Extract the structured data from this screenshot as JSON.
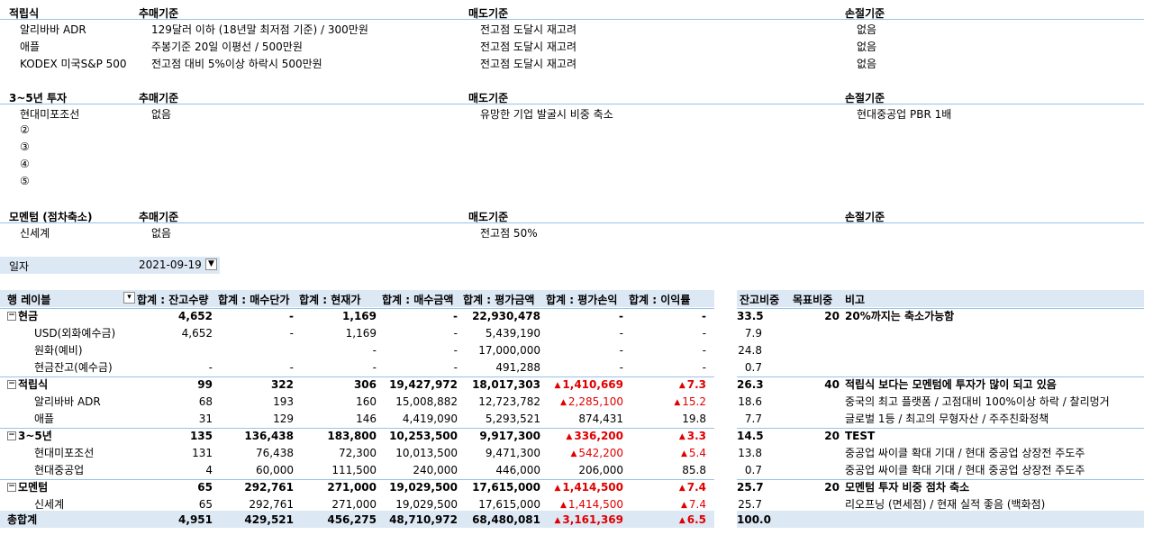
{
  "sections": [
    {
      "title": "적립식",
      "buy_hdr": "추매기준",
      "sell_hdr": "매도기준",
      "stop_hdr": "손절기준",
      "rows": [
        {
          "name": "알리바바 ADR",
          "buy": "129달러 이하 (18년말 최저점 기준) / 300만원",
          "sell": "전고점 도달시 재고려",
          "stop": "없음"
        },
        {
          "name": "애플",
          "buy": "주봉기준 20일 이평선 / 500만원",
          "sell": "전고점 도달시 재고려",
          "stop": "없음"
        },
        {
          "name": "KODEX 미국S&P 500",
          "buy": "전고점 대비 5%이상 하락시 500만원",
          "sell": "전고점 도달시 재고려",
          "stop": "없음"
        }
      ]
    },
    {
      "title": "3~5년 투자",
      "buy_hdr": "추매기준",
      "sell_hdr": "매도기준",
      "stop_hdr": "손절기준",
      "rows": [
        {
          "name": "현대미포조선",
          "buy": "없음",
          "sell": "유망한 기업 발굴시 비중 축소",
          "stop": "현대중공업 PBR 1배"
        },
        {
          "name": "②",
          "buy": "",
          "sell": "",
          "stop": ""
        },
        {
          "name": "③",
          "buy": "",
          "sell": "",
          "stop": ""
        },
        {
          "name": "④",
          "buy": "",
          "sell": "",
          "stop": ""
        },
        {
          "name": "⑤",
          "buy": "",
          "sell": "",
          "stop": ""
        }
      ]
    },
    {
      "title": "모멘텀 (점차축소)",
      "buy_hdr": "추매기준",
      "sell_hdr": "매도기준",
      "stop_hdr": "손절기준",
      "rows": [
        {
          "name": "신세계",
          "buy": "없음",
          "sell": "전고점 50%",
          "stop": ""
        }
      ]
    }
  ],
  "filter": {
    "label": "일자",
    "value": "2021-09-19",
    "icon": "filter-icon"
  },
  "pivot": {
    "headers": [
      "행 레이블",
      "합계 : 잔고수량",
      "합계 : 매수단가",
      "합계 : 현재가",
      "합계 : 매수금액",
      "합계 : 평가금액",
      "합계 : 평가손익",
      "합계 : 이익률"
    ],
    "rows": [
      {
        "label": "현금",
        "level": 0,
        "cells": [
          "4,652",
          "-",
          "1,169",
          "-",
          "22,930,478",
          "-",
          "-"
        ],
        "pl_neg": false,
        "rate_neg": false
      },
      {
        "label": "USD(외화예수금)",
        "level": 1,
        "cells": [
          "4,652",
          "-",
          "1,169",
          "-",
          "5,439,190",
          "-",
          "-"
        ],
        "pl_neg": false,
        "rate_neg": false
      },
      {
        "label": "원화(예비)",
        "level": 1,
        "cells": [
          "",
          "",
          "-",
          "-",
          "17,000,000",
          "-",
          "-"
        ],
        "pl_neg": false,
        "rate_neg": false
      },
      {
        "label": "현금잔고(예수금)",
        "level": 1,
        "cells": [
          "-",
          "-",
          "-",
          "-",
          "491,288",
          "-",
          "-"
        ],
        "pl_neg": false,
        "rate_neg": false
      },
      {
        "label": "적립식",
        "level": 0,
        "cells": [
          "99",
          "322",
          "306",
          "19,427,972",
          "18,017,303",
          "1,410,669",
          "7.3"
        ],
        "pl_neg": true,
        "rate_neg": true
      },
      {
        "label": "알리바바 ADR",
        "level": 1,
        "cells": [
          "68",
          "193",
          "160",
          "15,008,882",
          "12,723,782",
          "2,285,100",
          "15.2"
        ],
        "pl_neg": true,
        "rate_neg": true
      },
      {
        "label": "애플",
        "level": 1,
        "cells": [
          "31",
          "129",
          "146",
          "4,419,090",
          "5,293,521",
          "874,431",
          "19.8"
        ],
        "pl_neg": false,
        "rate_neg": false
      },
      {
        "label": "3~5년",
        "level": 0,
        "cells": [
          "135",
          "136,438",
          "183,800",
          "10,253,500",
          "9,917,300",
          "336,200",
          "3.3"
        ],
        "pl_neg": true,
        "rate_neg": true
      },
      {
        "label": "현대미포조선",
        "level": 1,
        "cells": [
          "131",
          "76,438",
          "72,300",
          "10,013,500",
          "9,471,300",
          "542,200",
          "5.4"
        ],
        "pl_neg": true,
        "rate_neg": true
      },
      {
        "label": "현대중공업",
        "level": 1,
        "cells": [
          "4",
          "60,000",
          "111,500",
          "240,000",
          "446,000",
          "206,000",
          "85.8"
        ],
        "pl_neg": false,
        "rate_neg": false
      },
      {
        "label": "모멘텀",
        "level": 0,
        "cells": [
          "65",
          "292,761",
          "271,000",
          "19,029,500",
          "17,615,000",
          "1,414,500",
          "7.4"
        ],
        "pl_neg": true,
        "rate_neg": true
      },
      {
        "label": "신세계",
        "level": 1,
        "cells": [
          "65",
          "292,761",
          "271,000",
          "19,029,500",
          "17,615,000",
          "1,414,500",
          "7.4"
        ],
        "pl_neg": true,
        "rate_neg": true
      }
    ],
    "total": {
      "label": "총합계",
      "cells": [
        "4,951",
        "429,521",
        "456,275",
        "48,710,972",
        "68,480,081",
        "3,161,369",
        "6.5"
      ],
      "pl_neg": true,
      "rate_neg": true
    }
  },
  "side": {
    "headers": [
      "잔고비중",
      "목표비중",
      "비고"
    ],
    "rows": [
      {
        "w": "33.5",
        "t": "20",
        "note": "20%까지는 축소가능함"
      },
      {
        "w": "7.9",
        "t": "",
        "note": ""
      },
      {
        "w": "24.8",
        "t": "",
        "note": ""
      },
      {
        "w": "0.7",
        "t": "",
        "note": ""
      },
      {
        "w": "26.3",
        "t": "40",
        "note": "적립식 보다는 모멘텀에 투자가 많이 되고 있음"
      },
      {
        "w": "18.6",
        "t": "",
        "note": "중국의 최고 플랫폼 / 고점대비 100%이상 하락 / 찰리멍거"
      },
      {
        "w": "7.7",
        "t": "",
        "note": "글로벌 1등 / 최고의 무형자산 / 주주친화정책"
      },
      {
        "w": "14.5",
        "t": "20",
        "note": "TEST"
      },
      {
        "w": "13.8",
        "t": "",
        "note": "중공업 싸이클 확대 기대 / 현대 중공업 상장전 주도주"
      },
      {
        "w": "0.7",
        "t": "",
        "note": "중공업 싸이클 확대 기대 / 현대 중공업 상장전 주도주"
      },
      {
        "w": "25.7",
        "t": "20",
        "note": "모멘텀 투자 비중 점차 축소"
      },
      {
        "w": "25.7",
        "t": "",
        "note": "리오프닝 (면세점) / 현재 실적 좋음 (백화점)"
      }
    ],
    "total": {
      "w": "100.0",
      "t": "",
      "note": ""
    }
  },
  "colors": {
    "red": "#e00000",
    "band": "#dde8f5",
    "line": "#9bc2e6"
  }
}
